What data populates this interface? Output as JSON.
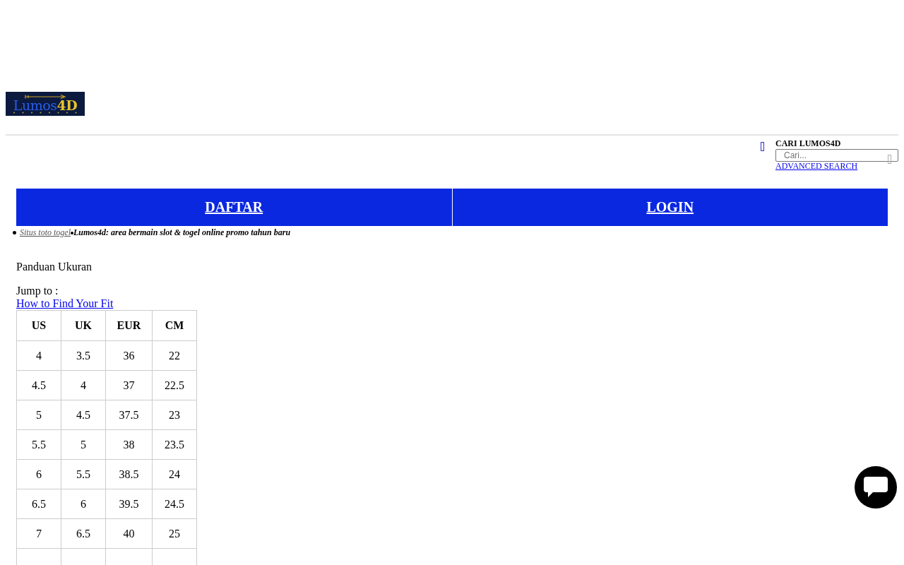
{
  "header": {
    "logo": {
      "text_1": "Lumos",
      "text_2": "4D"
    }
  },
  "search_widget": {
    "title": "CARI LUMOS4D",
    "search": {
      "placeholder": "Cari..."
    },
    "advanced_link": "ADVANCED SEARCH"
  },
  "auth_buttons": [
    "DAFTAR",
    "LOGIN"
  ],
  "breadcrumb": {
    "link": "Situs toto togel",
    "current": "Lumos4d: area bermain slot & togel online promo tahun baru"
  },
  "page_title": "Panduan Ukuran",
  "jump_to": {
    "label": "Jump to :",
    "links": [
      "How to Find Your Fit"
    ]
  },
  "size_table": {
    "columns": [
      "US",
      "UK",
      "EUR",
      "CM"
    ],
    "rows": [
      [
        "4",
        "3.5",
        "36",
        "22"
      ],
      [
        "4.5",
        "4",
        "37",
        "22.5"
      ],
      [
        "5",
        "4.5",
        "37.5",
        "23"
      ],
      [
        "5.5",
        "5",
        "38",
        "23.5"
      ],
      [
        "6",
        "5.5",
        "38.5",
        "24"
      ],
      [
        "6.5",
        "6",
        "39.5",
        "24.5"
      ],
      [
        "7",
        "6.5",
        "40",
        "25"
      ]
    ]
  }
}
